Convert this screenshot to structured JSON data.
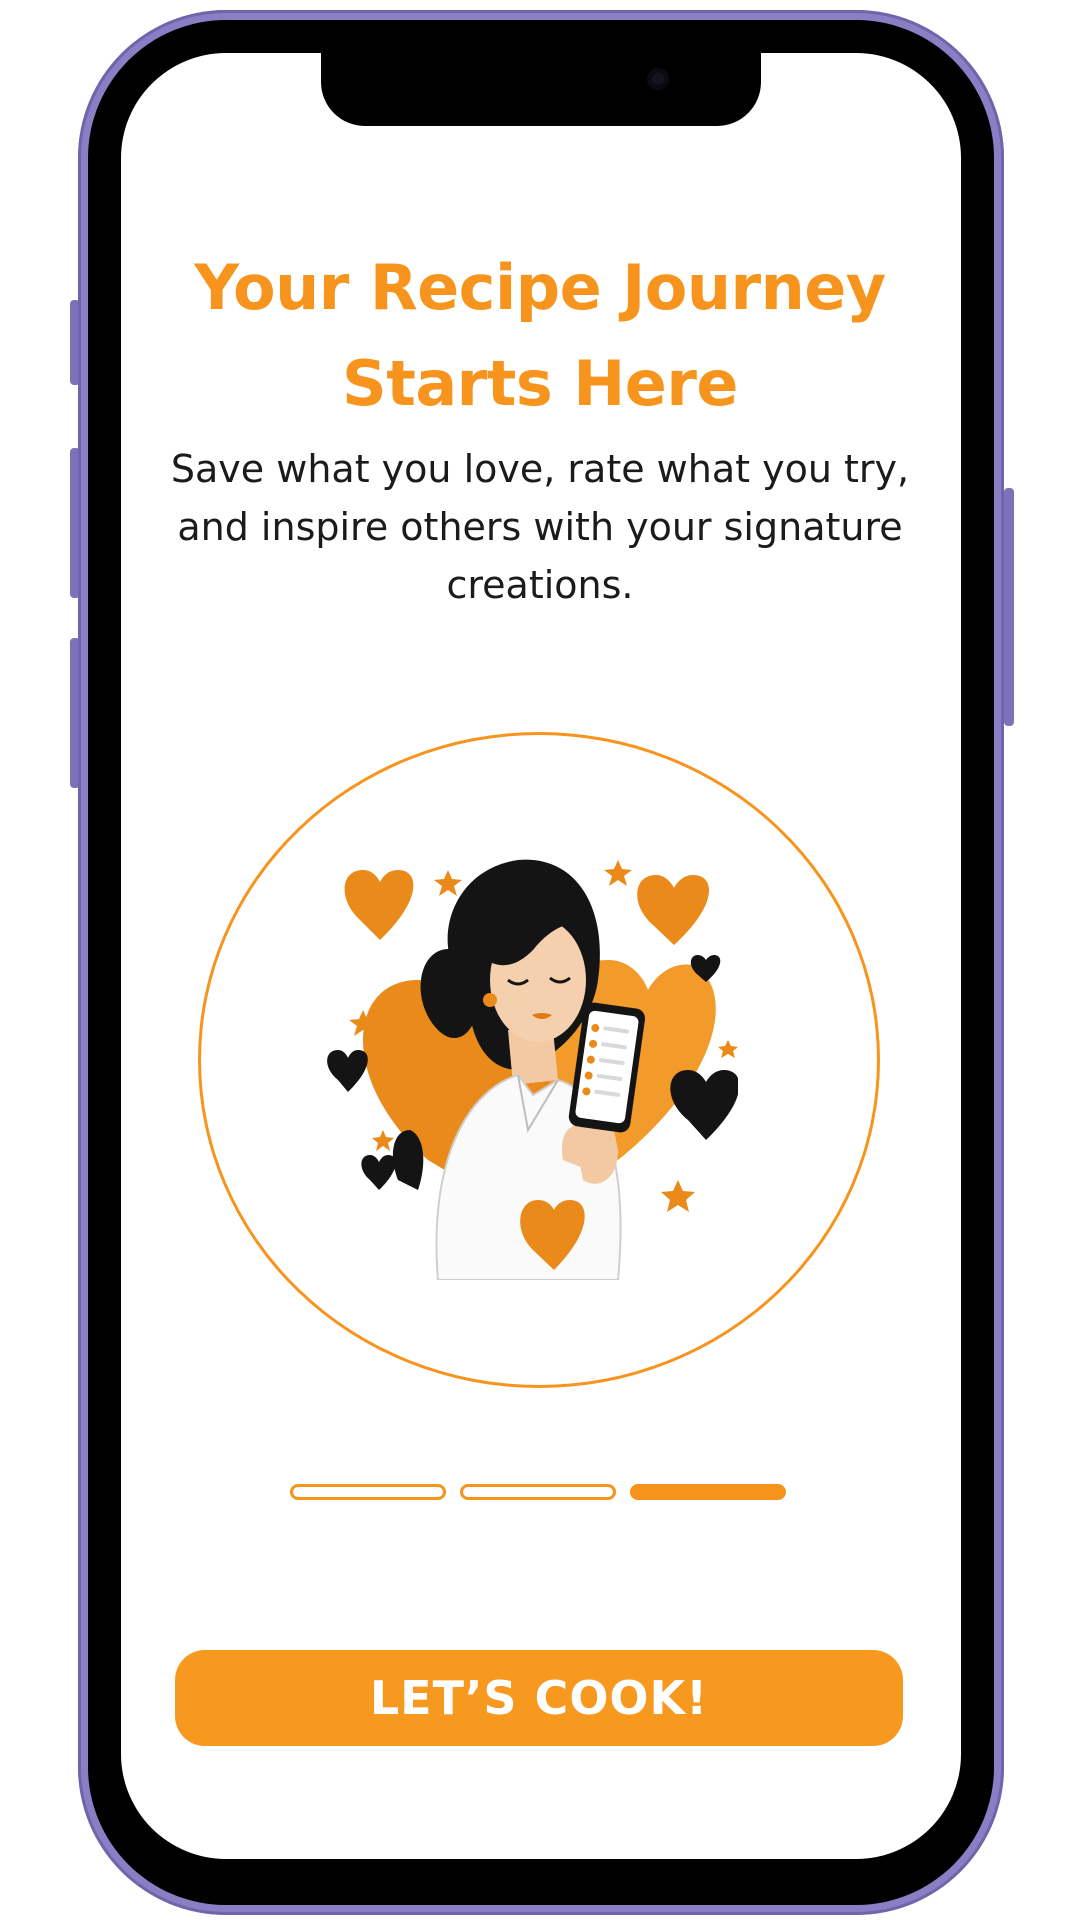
{
  "onboarding": {
    "title_line1": "Your Recipe Journey",
    "title_line2": "Starts Here",
    "description": "Save what you love, rate what you try, and inspire others with your signature creations.",
    "illustration_icon": "woman-holding-phone-with-hearts-illustration",
    "pager": {
      "total": 3,
      "active_index": 2
    },
    "cta_label": "LET’S COOK!"
  },
  "colors": {
    "accent": "#f7941e",
    "button": "#f7991f",
    "text": "#1b1b1b",
    "phone_frame": "#8a7fc4"
  }
}
